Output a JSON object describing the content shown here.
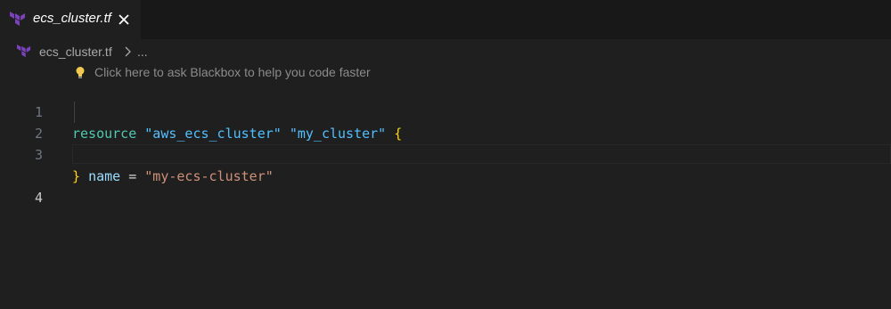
{
  "tab": {
    "filename": "ecs_cluster.tf",
    "file_icon": "terraform-icon",
    "close_icon": "close-icon"
  },
  "breadcrumb": {
    "file": "ecs_cluster.tf",
    "separator_icon": "chevron-right-icon",
    "more": "..."
  },
  "hint": {
    "icon": "lightbulb-icon",
    "text": "Click here to ask Blackbox to help you code faster"
  },
  "editor": {
    "active_line": "4",
    "lines": [
      {
        "number": "1",
        "tokens": [
          "resource",
          " ",
          "\"aws_ecs_cluster\"",
          " ",
          "\"my_cluster\"",
          " ",
          "{"
        ]
      },
      {
        "number": "2",
        "tokens": [
          "  ",
          "name",
          " = ",
          "\"my-ecs-cluster\""
        ]
      },
      {
        "number": "3",
        "tokens": [
          "}"
        ]
      },
      {
        "number": "4",
        "tokens": []
      }
    ]
  },
  "colors": {
    "background": "#1f1f1f",
    "tab_bar": "#181818",
    "terraform_purple": "#7b42bc",
    "keyword": "#4ec9b0",
    "string": "#ce9178",
    "type_string": "#4fc1ff",
    "attribute": "#9cdcfe",
    "brace": "#ffd700"
  }
}
